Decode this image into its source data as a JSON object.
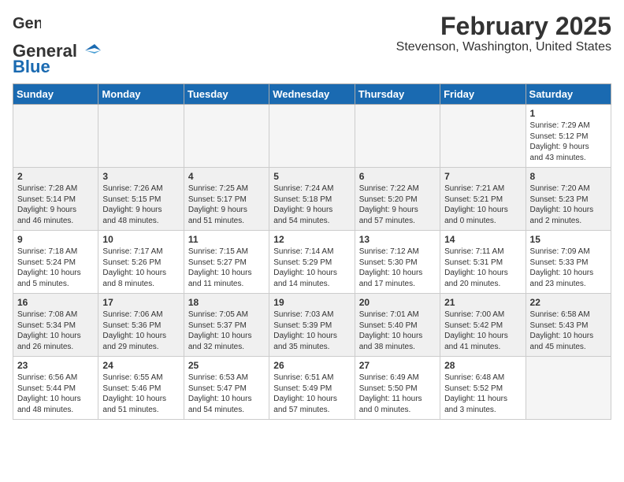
{
  "logo": {
    "text_general": "General",
    "text_blue": "Blue",
    "icon": "▶"
  },
  "title": "February 2025",
  "subtitle": "Stevenson, Washington, United States",
  "days_of_week": [
    "Sunday",
    "Monday",
    "Tuesday",
    "Wednesday",
    "Thursday",
    "Friday",
    "Saturday"
  ],
  "weeks": [
    {
      "shade": false,
      "days": [
        {
          "num": "",
          "info": ""
        },
        {
          "num": "",
          "info": ""
        },
        {
          "num": "",
          "info": ""
        },
        {
          "num": "",
          "info": ""
        },
        {
          "num": "",
          "info": ""
        },
        {
          "num": "",
          "info": ""
        },
        {
          "num": "1",
          "info": "Sunrise: 7:29 AM\nSunset: 5:12 PM\nDaylight: 9 hours\nand 43 minutes."
        }
      ]
    },
    {
      "shade": true,
      "days": [
        {
          "num": "2",
          "info": "Sunrise: 7:28 AM\nSunset: 5:14 PM\nDaylight: 9 hours\nand 46 minutes."
        },
        {
          "num": "3",
          "info": "Sunrise: 7:26 AM\nSunset: 5:15 PM\nDaylight: 9 hours\nand 48 minutes."
        },
        {
          "num": "4",
          "info": "Sunrise: 7:25 AM\nSunset: 5:17 PM\nDaylight: 9 hours\nand 51 minutes."
        },
        {
          "num": "5",
          "info": "Sunrise: 7:24 AM\nSunset: 5:18 PM\nDaylight: 9 hours\nand 54 minutes."
        },
        {
          "num": "6",
          "info": "Sunrise: 7:22 AM\nSunset: 5:20 PM\nDaylight: 9 hours\nand 57 minutes."
        },
        {
          "num": "7",
          "info": "Sunrise: 7:21 AM\nSunset: 5:21 PM\nDaylight: 10 hours\nand 0 minutes."
        },
        {
          "num": "8",
          "info": "Sunrise: 7:20 AM\nSunset: 5:23 PM\nDaylight: 10 hours\nand 2 minutes."
        }
      ]
    },
    {
      "shade": false,
      "days": [
        {
          "num": "9",
          "info": "Sunrise: 7:18 AM\nSunset: 5:24 PM\nDaylight: 10 hours\nand 5 minutes."
        },
        {
          "num": "10",
          "info": "Sunrise: 7:17 AM\nSunset: 5:26 PM\nDaylight: 10 hours\nand 8 minutes."
        },
        {
          "num": "11",
          "info": "Sunrise: 7:15 AM\nSunset: 5:27 PM\nDaylight: 10 hours\nand 11 minutes."
        },
        {
          "num": "12",
          "info": "Sunrise: 7:14 AM\nSunset: 5:29 PM\nDaylight: 10 hours\nand 14 minutes."
        },
        {
          "num": "13",
          "info": "Sunrise: 7:12 AM\nSunset: 5:30 PM\nDaylight: 10 hours\nand 17 minutes."
        },
        {
          "num": "14",
          "info": "Sunrise: 7:11 AM\nSunset: 5:31 PM\nDaylight: 10 hours\nand 20 minutes."
        },
        {
          "num": "15",
          "info": "Sunrise: 7:09 AM\nSunset: 5:33 PM\nDaylight: 10 hours\nand 23 minutes."
        }
      ]
    },
    {
      "shade": true,
      "days": [
        {
          "num": "16",
          "info": "Sunrise: 7:08 AM\nSunset: 5:34 PM\nDaylight: 10 hours\nand 26 minutes."
        },
        {
          "num": "17",
          "info": "Sunrise: 7:06 AM\nSunset: 5:36 PM\nDaylight: 10 hours\nand 29 minutes."
        },
        {
          "num": "18",
          "info": "Sunrise: 7:05 AM\nSunset: 5:37 PM\nDaylight: 10 hours\nand 32 minutes."
        },
        {
          "num": "19",
          "info": "Sunrise: 7:03 AM\nSunset: 5:39 PM\nDaylight: 10 hours\nand 35 minutes."
        },
        {
          "num": "20",
          "info": "Sunrise: 7:01 AM\nSunset: 5:40 PM\nDaylight: 10 hours\nand 38 minutes."
        },
        {
          "num": "21",
          "info": "Sunrise: 7:00 AM\nSunset: 5:42 PM\nDaylight: 10 hours\nand 41 minutes."
        },
        {
          "num": "22",
          "info": "Sunrise: 6:58 AM\nSunset: 5:43 PM\nDaylight: 10 hours\nand 45 minutes."
        }
      ]
    },
    {
      "shade": false,
      "days": [
        {
          "num": "23",
          "info": "Sunrise: 6:56 AM\nSunset: 5:44 PM\nDaylight: 10 hours\nand 48 minutes."
        },
        {
          "num": "24",
          "info": "Sunrise: 6:55 AM\nSunset: 5:46 PM\nDaylight: 10 hours\nand 51 minutes."
        },
        {
          "num": "25",
          "info": "Sunrise: 6:53 AM\nSunset: 5:47 PM\nDaylight: 10 hours\nand 54 minutes."
        },
        {
          "num": "26",
          "info": "Sunrise: 6:51 AM\nSunset: 5:49 PM\nDaylight: 10 hours\nand 57 minutes."
        },
        {
          "num": "27",
          "info": "Sunrise: 6:49 AM\nSunset: 5:50 PM\nDaylight: 11 hours\nand 0 minutes."
        },
        {
          "num": "28",
          "info": "Sunrise: 6:48 AM\nSunset: 5:52 PM\nDaylight: 11 hours\nand 3 minutes."
        },
        {
          "num": "",
          "info": ""
        }
      ]
    }
  ]
}
